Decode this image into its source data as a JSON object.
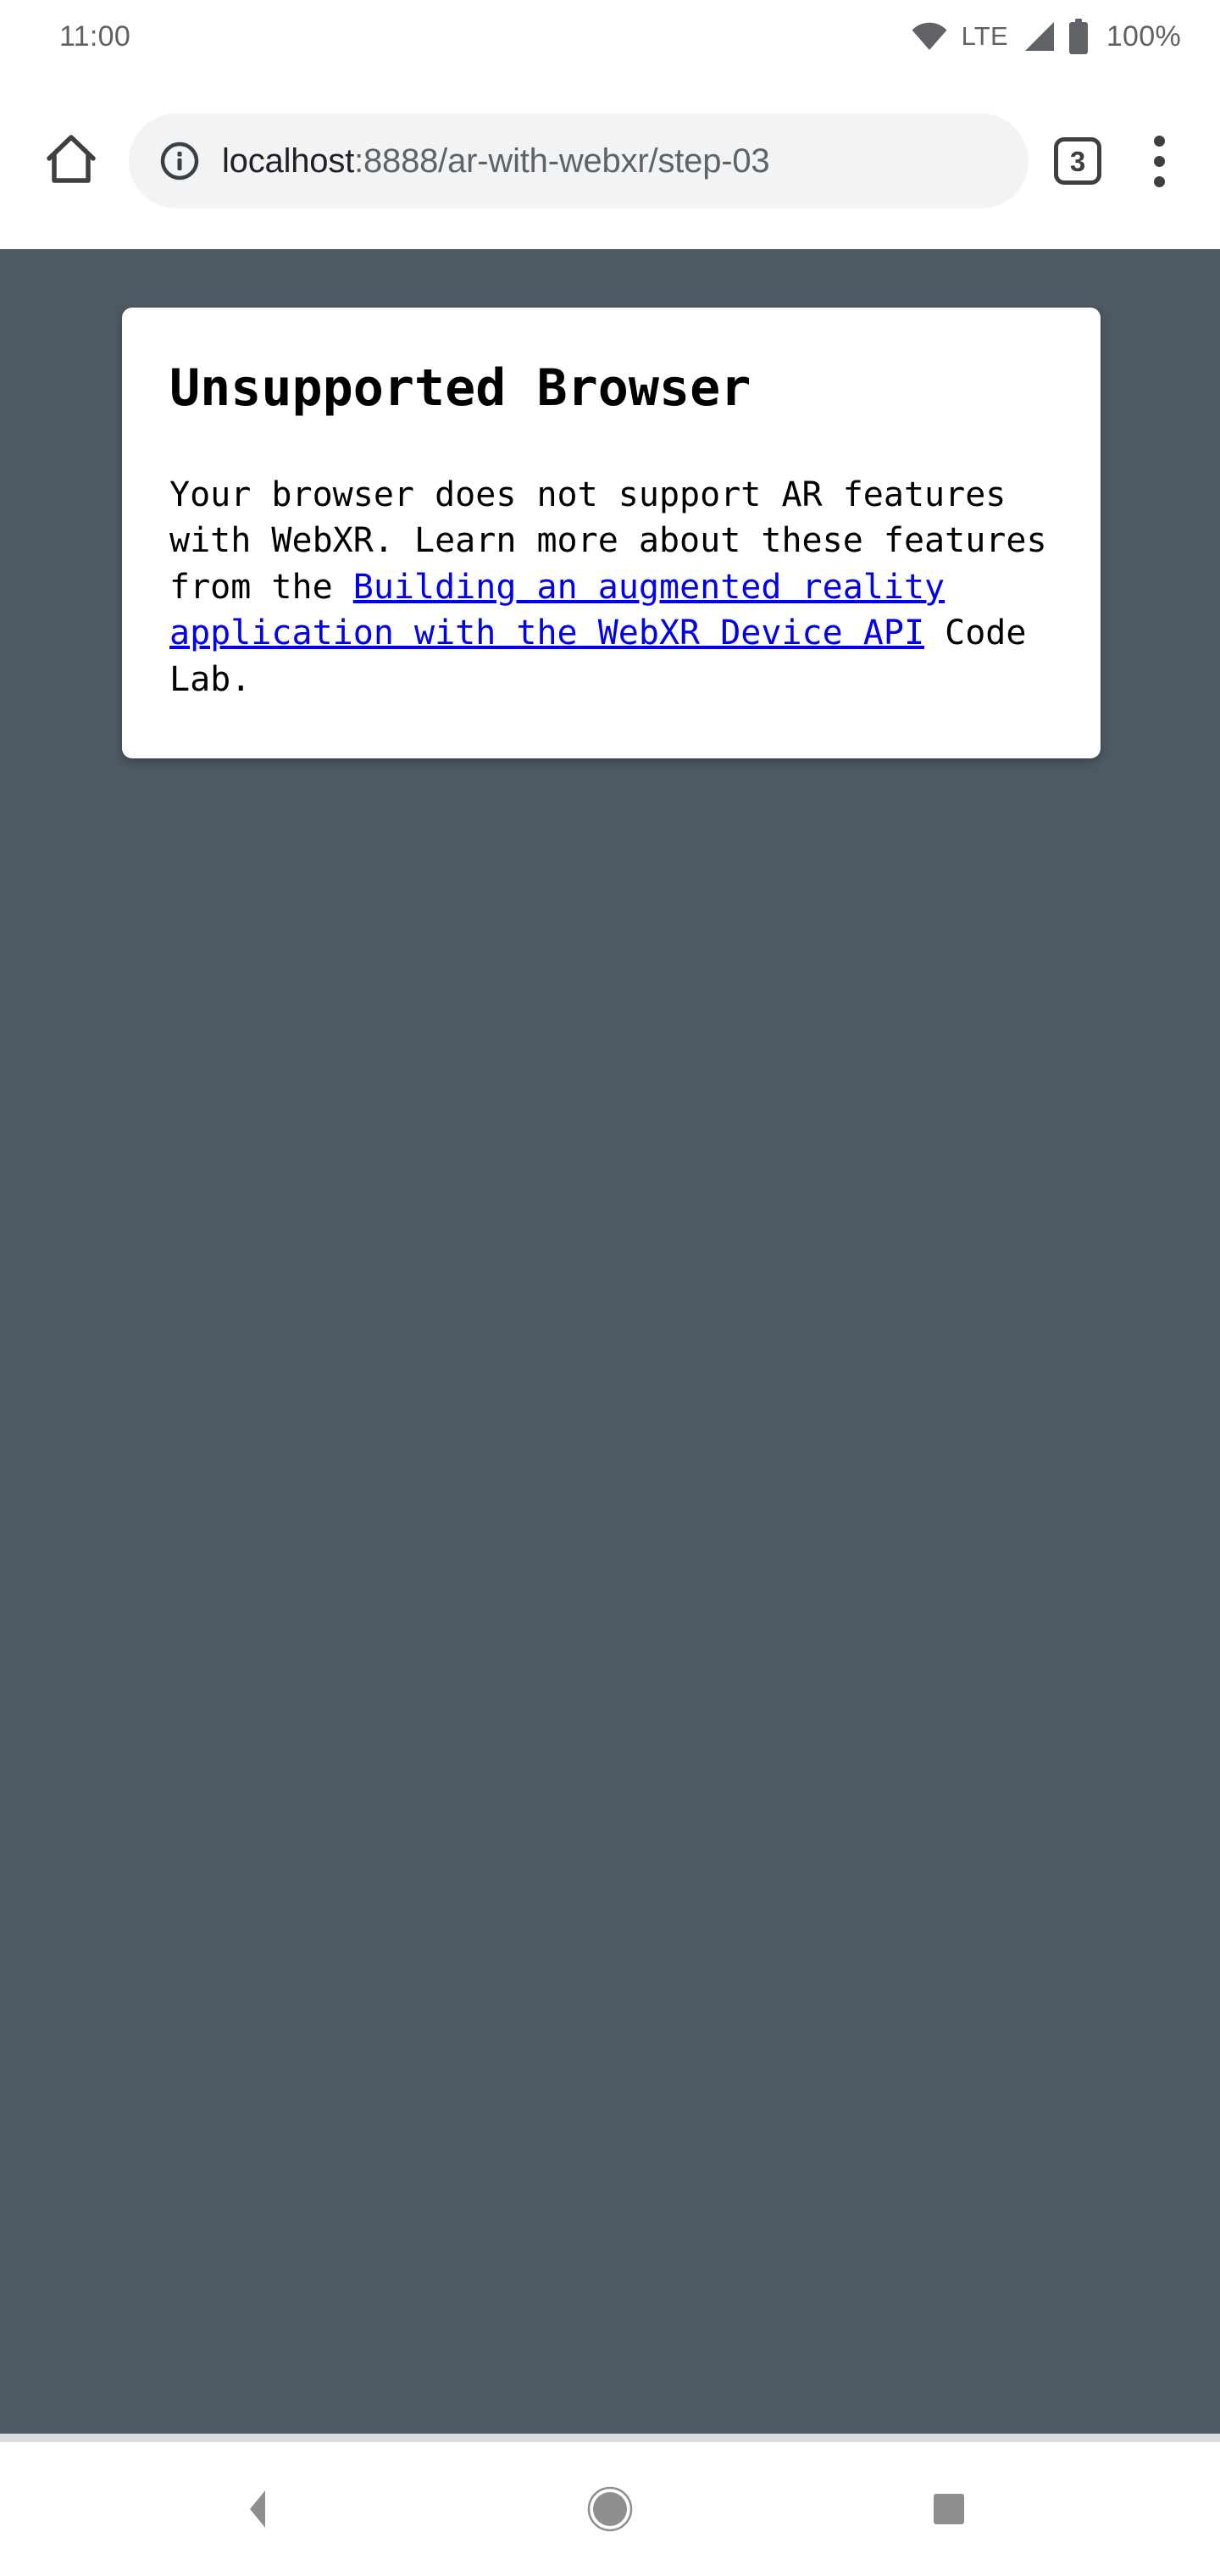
{
  "status_bar": {
    "clock": "11:00",
    "wifi_icon": "wifi-icon",
    "network_label": "LTE",
    "signal_icon": "cell-signal-icon",
    "battery_icon": "battery-full-icon",
    "battery_percent": "100%"
  },
  "browser": {
    "home_icon": "home-icon",
    "site_info_icon": "info-circle-icon",
    "url_host": "localhost",
    "url_rest": ":8888/ar-with-webxr/step-03",
    "url_full": "localhost:8888/ar-with-webxr/step-03",
    "tab_count": "3",
    "menu_icon": "overflow-menu-icon"
  },
  "page": {
    "background_color": "#4d5a63",
    "card": {
      "title": "Unsupported Browser",
      "body_before_link": "Your browser does not support AR features with WebXR. Learn more about these features from the ",
      "link_text": "Building an augmented reality application with the WebXR Device API",
      "body_after_link": " Code Lab.",
      "link_color": "#0000ee"
    }
  },
  "nav_bar": {
    "back_icon": "back-triangle-icon",
    "home_icon": "home-circle-icon",
    "recents_icon": "recents-square-icon"
  }
}
